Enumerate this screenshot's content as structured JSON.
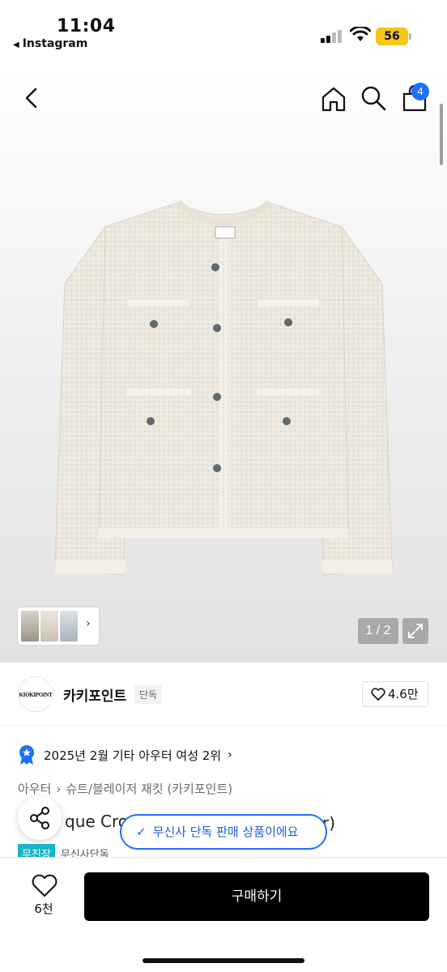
{
  "status_bar": {
    "time": "11:04",
    "back_app": "Instagram",
    "battery": "56"
  },
  "nav": {
    "cart_count": "4"
  },
  "gallery": {
    "pager": "1 / 2"
  },
  "brand": {
    "logo_text": "KIOKIPOINT",
    "name": "카키포인트",
    "badge": "단독",
    "likes": "4.6만"
  },
  "ranking": {
    "text": "2025년 2월 기타 아우터 여성 2위"
  },
  "breadcrumb": {
    "items": [
      "아우터",
      "슈트/블레이저 재킷 (카키포인트)"
    ]
  },
  "product": {
    "title_visible_start": "que Cro",
    "title_visible_end": "r)"
  },
  "toast": {
    "text": "무신사 단독 판매 상품이에요"
  },
  "tags": {
    "free_shipping": "무진장",
    "exclusive": "무신사단독"
  },
  "bottom": {
    "like_count": "6천",
    "buy_label": "구매하기"
  },
  "colors": {
    "accent_blue": "#1e6fff",
    "tag_teal": "#17b6c8",
    "battery_yellow": "#f5c518"
  }
}
